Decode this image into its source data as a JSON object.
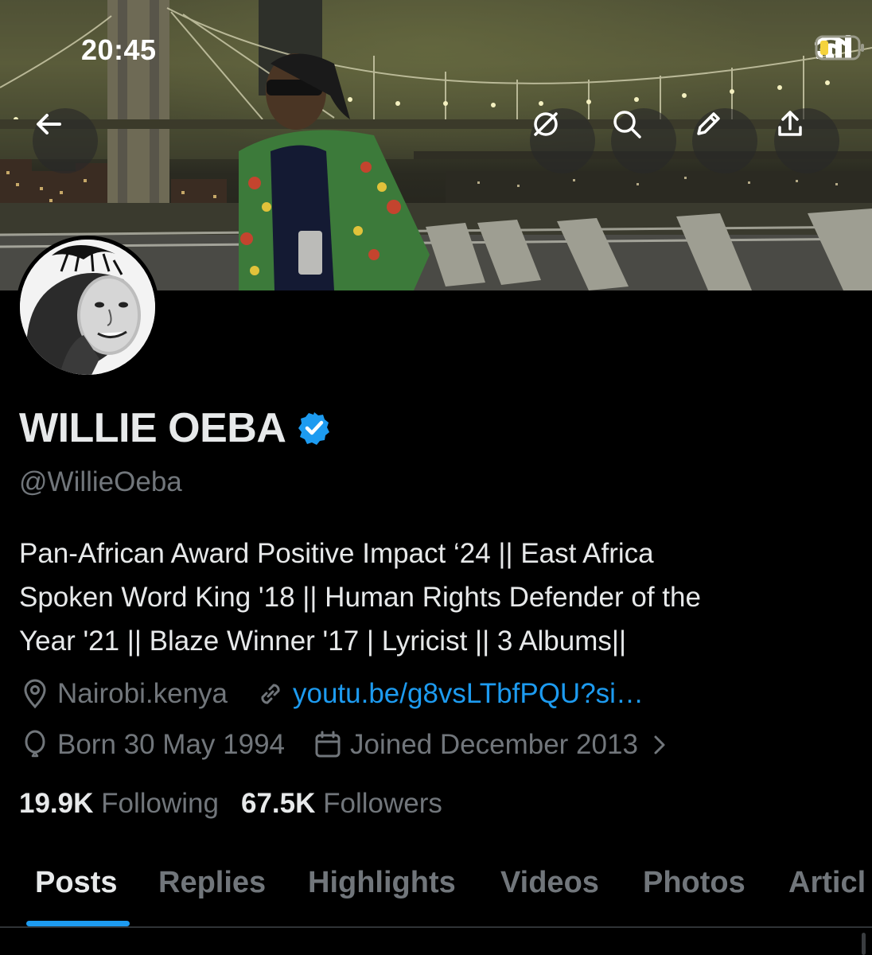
{
  "status_bar": {
    "time": "20:45"
  },
  "header": {
    "back_icon": "arrow-left-icon",
    "actions": [
      "no-feeds-icon",
      "search-icon",
      "edit-pencil-icon",
      "share-upload-icon"
    ]
  },
  "profile": {
    "name": "WILLIE OEBA",
    "verified": true,
    "handle": "@WillieOeba",
    "bio_lines": [
      "Pan-African Award Positive Impact ‘24 || East Africa",
      "Spoken Word King '18 || Human Rights Defender of the",
      "Year '21 || Blaze Winner '17 | Lyricist || 3 Albums||"
    ],
    "location": "Nairobi.kenya",
    "link": "youtu.be/g8vsLTbfPQU?si…",
    "born": "Born 30 May 1994",
    "joined": "Joined December 2013",
    "following_count": "19.9K",
    "following_label": "Following",
    "followers_count": "67.5K",
    "followers_label": "Followers"
  },
  "tabs": [
    {
      "label": "Posts",
      "active": true
    },
    {
      "label": "Replies",
      "active": false
    },
    {
      "label": "Highlights",
      "active": false
    },
    {
      "label": "Videos",
      "active": false
    },
    {
      "label": "Photos",
      "active": false
    },
    {
      "label": "Articl",
      "active": false
    }
  ],
  "colors": {
    "accent": "#1d9bf0",
    "secondary_text": "#71767b",
    "primary_text": "#e7e9ea",
    "background": "#000000"
  }
}
